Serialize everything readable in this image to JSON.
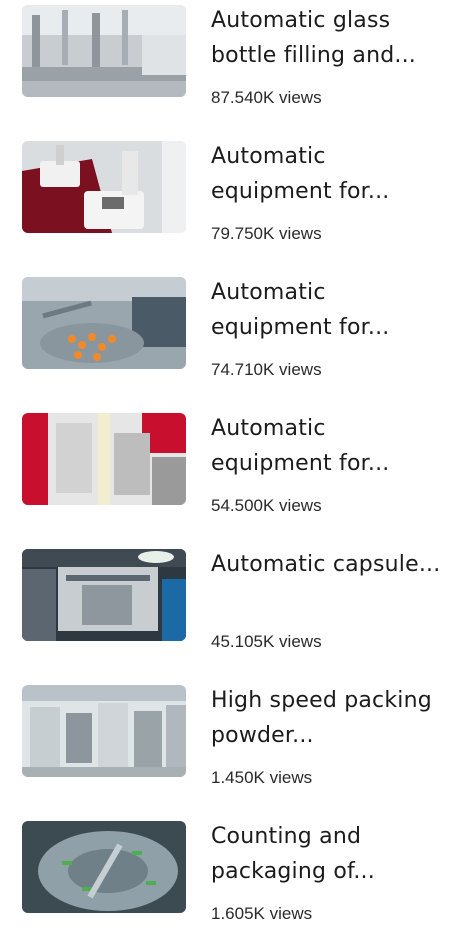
{
  "videos": [
    {
      "title": "Automatic glass bottle filling and...",
      "views": "87.540K views",
      "thumb_icon": "bottle-filling-line-thumbnail",
      "thumb_colors": [
        "#c9ccd0",
        "#8e969c",
        "#e9ecef"
      ]
    },
    {
      "title": "Automatic equipment for...",
      "views": "79.750K views",
      "thumb_icon": "tablet-testing-device-thumbnail",
      "thumb_colors": [
        "#7a1020",
        "#f1f1f1",
        "#d9dde0"
      ]
    },
    {
      "title": "Automatic equipment for...",
      "views": "74.710K views",
      "thumb_icon": "rotary-vial-machine-thumbnail",
      "thumb_colors": [
        "#4a5a66",
        "#f08a2a",
        "#9aa6ad"
      ]
    },
    {
      "title": "Automatic equipment for...",
      "views": "54.500K views",
      "thumb_icon": "packing-machine-red-thumbnail",
      "thumb_colors": [
        "#c8102e",
        "#e6e6e6",
        "#9a9a9a"
      ]
    },
    {
      "title": "Automatic capsule...",
      "views": "45.105K views",
      "thumb_icon": "capsule-filling-machine-thumbnail",
      "thumb_colors": [
        "#5b6670",
        "#c8cdd1",
        "#2e3840"
      ]
    },
    {
      "title": "High speed packing powder...",
      "views": "1.450K views",
      "thumb_icon": "powder-packing-hall-thumbnail",
      "thumb_colors": [
        "#b9c2c8",
        "#8c969c",
        "#dfe4e6"
      ]
    },
    {
      "title": "Counting and packaging of...",
      "views": "1.605K views",
      "thumb_icon": "counting-machine-thumbnail",
      "thumb_colors": [
        "#3c4a52",
        "#8fa0a8",
        "#4caf50"
      ]
    }
  ]
}
